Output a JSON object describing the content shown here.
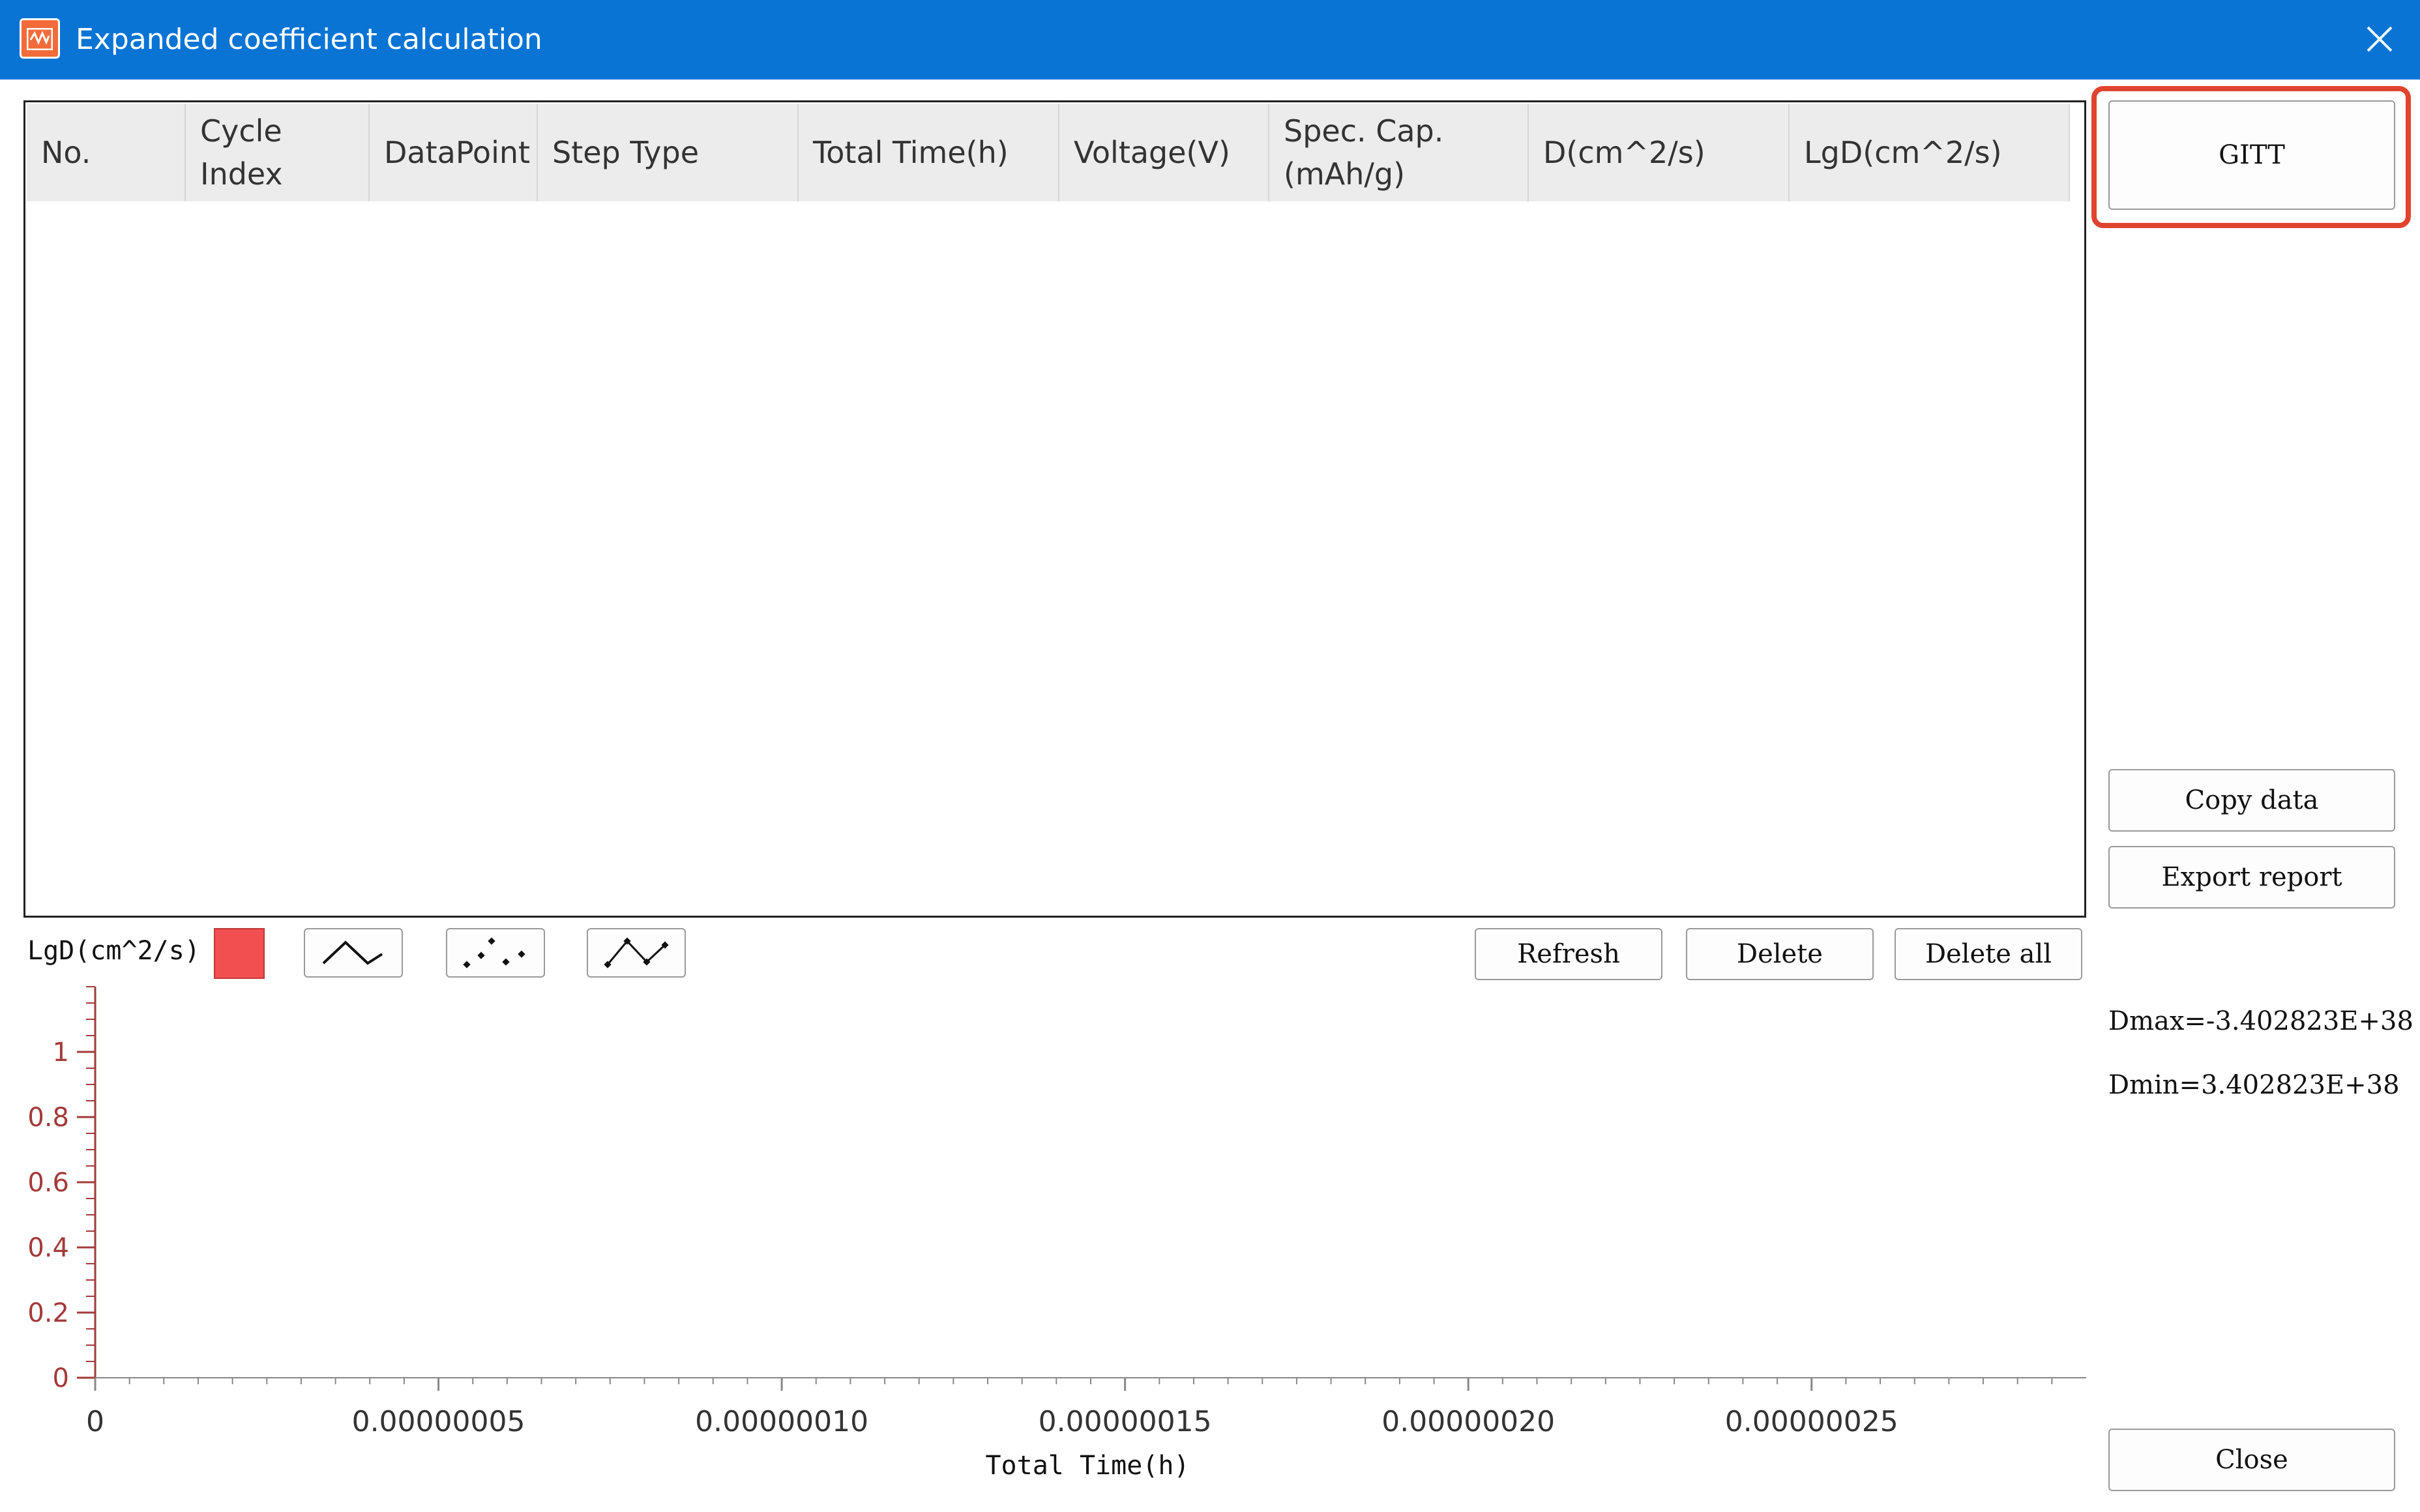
{
  "window": {
    "title": "Expanded coefficient calculation"
  },
  "table": {
    "columns": [
      "No.",
      "Cycle Index",
      "DataPoint",
      "Step Type",
      "Total Time(h)",
      "Voltage(V)",
      "Spec. Cap.(mAh/g)",
      "D(cm^2/s)",
      "LgD(cm^2/s)"
    ],
    "rows": []
  },
  "sidebar": {
    "gitt_label": "GITT",
    "copy_label": "Copy data",
    "export_label": "Export report",
    "close_label": "Close",
    "dmax": "Dmax=-3.402823E+38",
    "dmin": "Dmin=3.402823E+38"
  },
  "chart_toolbar": {
    "series_label": "LgD(cm^2/s)",
    "series_color": "#f25050",
    "refresh_label": "Refresh",
    "delete_label": "Delete",
    "delete_all_label": "Delete all"
  },
  "chart_data": {
    "type": "line",
    "x": [],
    "series": [],
    "xlabel": "Total Time(h)",
    "ylabel": "",
    "xlim": [
      0,
      2.9e-07
    ],
    "ylim": [
      0,
      1.2
    ],
    "x_ticks": [
      "0",
      "0.00000005",
      "0.00000010",
      "0.00000015",
      "0.00000020",
      "0.00000025"
    ],
    "y_ticks": [
      "0",
      "0.2",
      "0.4",
      "0.6",
      "0.8",
      "1"
    ],
    "grid": false
  }
}
